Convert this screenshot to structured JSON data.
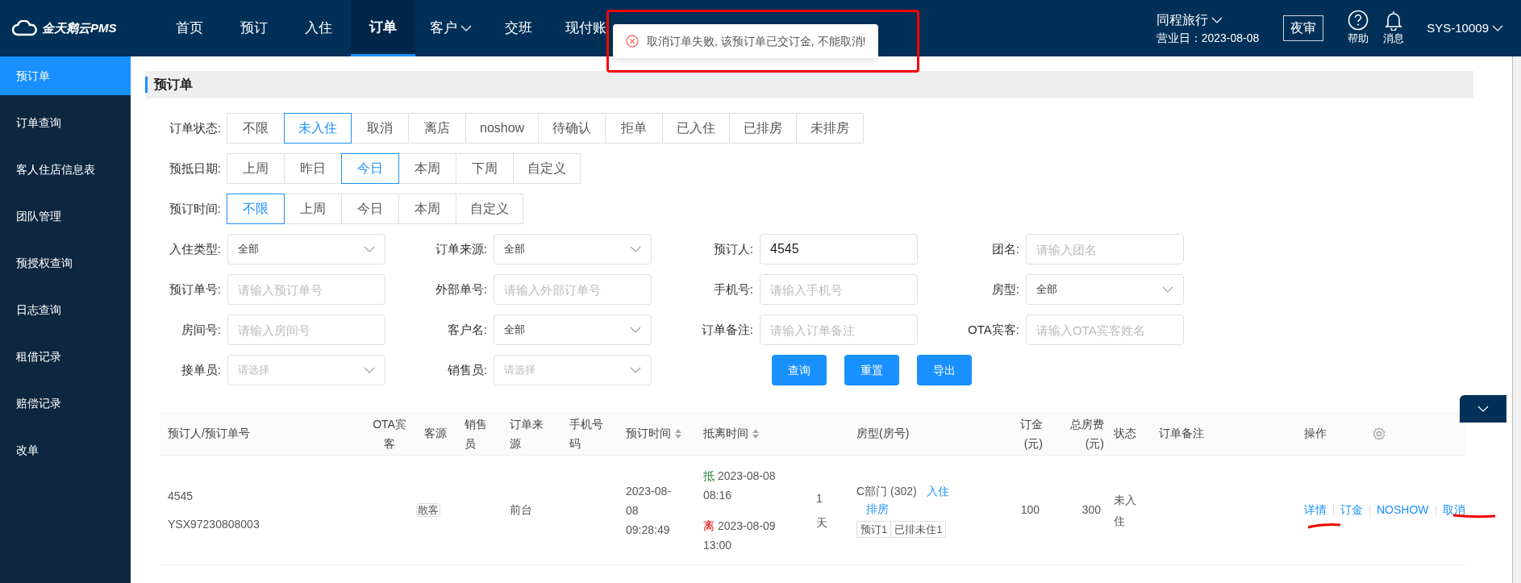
{
  "header": {
    "logo": "金天鹅云PMS",
    "nav": [
      {
        "label": "首页",
        "selected": false,
        "dropdown": false
      },
      {
        "label": "预订",
        "selected": false,
        "dropdown": false
      },
      {
        "label": "入住",
        "selected": false,
        "dropdown": false
      },
      {
        "label": "订单",
        "selected": true,
        "dropdown": false
      },
      {
        "label": "客户",
        "selected": false,
        "dropdown": true
      },
      {
        "label": "交班",
        "selected": false,
        "dropdown": false
      },
      {
        "label": "现付账",
        "selected": false,
        "dropdown": false
      }
    ],
    "hotel": "同程旅行",
    "business_day": "营业日：2023-08-08",
    "night_audit": "夜审",
    "help": "帮助",
    "messages": "消息",
    "user": "SYS-10009"
  },
  "toast": {
    "message": "取消订单失败, 该预订单已交订金, 不能取消!"
  },
  "sidebar": {
    "items": [
      {
        "label": "预订单",
        "selected": true
      },
      {
        "label": "订单查询",
        "selected": false
      },
      {
        "label": "客人住店信息表",
        "selected": false
      },
      {
        "label": "团队管理",
        "selected": false
      },
      {
        "label": "预授权查询",
        "selected": false
      },
      {
        "label": "日志查询",
        "selected": false
      },
      {
        "label": "租借记录",
        "selected": false
      },
      {
        "label": "赔偿记录",
        "selected": false
      },
      {
        "label": "改单",
        "selected": false
      }
    ]
  },
  "page_title": "预订单",
  "filter_groups": [
    {
      "label": "订单状态:",
      "options": [
        {
          "label": "不限",
          "selected": false
        },
        {
          "label": "未入住",
          "selected": true
        },
        {
          "label": "取消",
          "selected": false
        },
        {
          "label": "离店",
          "selected": false
        },
        {
          "label": "noshow",
          "selected": false
        },
        {
          "label": "待确认",
          "selected": false
        },
        {
          "label": "拒单",
          "selected": false
        },
        {
          "label": "已入住",
          "selected": false
        },
        {
          "label": "已排房",
          "selected": false
        },
        {
          "label": "未排房",
          "selected": false
        }
      ]
    },
    {
      "label": "预抵日期:",
      "options": [
        {
          "label": "上周",
          "selected": false
        },
        {
          "label": "昨日",
          "selected": false
        },
        {
          "label": "今日",
          "selected": true
        },
        {
          "label": "本周",
          "selected": false
        },
        {
          "label": "下周",
          "selected": false
        },
        {
          "label": "自定义",
          "selected": false
        }
      ]
    },
    {
      "label": "预订时间:",
      "options": [
        {
          "label": "不限",
          "selected": true
        },
        {
          "label": "上周",
          "selected": false
        },
        {
          "label": "今日",
          "selected": false
        },
        {
          "label": "本周",
          "selected": false
        },
        {
          "label": "自定义",
          "selected": false
        }
      ]
    }
  ],
  "fields": [
    {
      "kind": "select",
      "label": "入住类型:",
      "value": "全部"
    },
    {
      "kind": "select",
      "label": "订单来源:",
      "value": "全部"
    },
    {
      "kind": "input",
      "label": "预订人:",
      "value": "4545"
    },
    {
      "kind": "input",
      "label": "团名:",
      "placeholder": "请输入团名"
    },
    {
      "kind": "input",
      "label": "预订单号:",
      "placeholder": "请输入预订单号"
    },
    {
      "kind": "input",
      "label": "外部单号:",
      "placeholder": "请输入外部订单号"
    },
    {
      "kind": "input",
      "label": "手机号:",
      "placeholder": "请输入手机号"
    },
    {
      "kind": "select",
      "label": "房型:",
      "value": "全部"
    },
    {
      "kind": "input",
      "label": "房间号:",
      "placeholder": "请输入房间号"
    },
    {
      "kind": "select",
      "label": "客户名:",
      "value": "全部"
    },
    {
      "kind": "input",
      "label": "订单备注:",
      "placeholder": "请输入订单备注"
    },
    {
      "kind": "input",
      "label": "OTA宾客:",
      "placeholder": "请输入OTA宾客姓名"
    },
    {
      "kind": "select",
      "label": "接单员:",
      "placeholder": "请选择"
    },
    {
      "kind": "select",
      "label": "销售员:",
      "placeholder": "请选择"
    }
  ],
  "buttons": [
    "查询",
    "重置",
    "导出"
  ],
  "table": {
    "columns": [
      {
        "label": "预订人/预订单号",
        "sortable": false
      },
      {
        "label": "OTA宾客",
        "sortable": false
      },
      {
        "label": "客源",
        "sortable": false
      },
      {
        "label": "销售员",
        "sortable": false
      },
      {
        "label": "订单来源",
        "sortable": false
      },
      {
        "label": "手机号码",
        "sortable": false
      },
      {
        "label": "预订时间",
        "sortable": true
      },
      {
        "label": "抵离时间",
        "sortable": true
      },
      {
        "label": "房型(房号)",
        "sortable": false
      },
      {
        "label": "订金(元)",
        "sortable": false
      },
      {
        "label": "总房费(元)",
        "sortable": false
      },
      {
        "label": "状态",
        "sortable": false
      },
      {
        "label": "订单备注",
        "sortable": false
      },
      {
        "label": "操作",
        "sortable": false
      }
    ],
    "rows": [
      {
        "booker": "4545",
        "order_no": "YSX97230808003",
        "source": "散客",
        "channel": "前台",
        "booked_at": "2023-08-08 09:28:49",
        "arrive_label": "抵",
        "arrive": "2023-08-08 08:16",
        "depart_label": "离",
        "depart": "2023-08-09 13:00",
        "nights": "1 天",
        "room": "C部门 (302)",
        "room_links": [
          "入住",
          "排房"
        ],
        "room_tags": [
          "预订1",
          "已排未住1"
        ],
        "deposit": "100",
        "total": "300",
        "status": "未入住",
        "actions": [
          "详情",
          "订金",
          "NOSHOW",
          "取消"
        ]
      }
    ]
  }
}
